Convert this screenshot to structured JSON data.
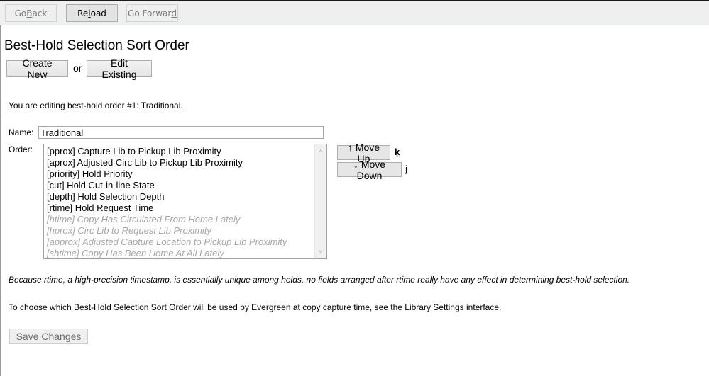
{
  "toolbar": {
    "back": {
      "pre": "Go ",
      "key": "B",
      "post": "ack"
    },
    "reload": {
      "pre": "Re",
      "key": "l",
      "post": "oad"
    },
    "forward": {
      "pre": "Go Forwar",
      "key": "d",
      "post": ""
    }
  },
  "page": {
    "title": "Best-Hold Selection Sort Order",
    "create_new": "Create New",
    "or": "or",
    "edit_existing": "Edit Existing",
    "editing_text": "You are editing best-hold order #1: Traditional.",
    "name_label": "Name:",
    "name_value": "Traditional",
    "order_label": "Order:",
    "order_items": [
      {
        "label": "[pprox] Capture Lib to Pickup Lib Proximity",
        "active": true
      },
      {
        "label": "[aprox] Adjusted Circ Lib to Pickup Lib Proximity",
        "active": true
      },
      {
        "label": "[priority] Hold Priority",
        "active": true
      },
      {
        "label": "[cut] Hold Cut-in-line State",
        "active": true
      },
      {
        "label": "[depth] Hold Selection Depth",
        "active": true
      },
      {
        "label": "[rtime] Hold Request Time",
        "active": true
      },
      {
        "label": "[htime] Copy Has Circulated From Home Lately",
        "active": false
      },
      {
        "label": "[hprox] Circ Lib to Request Lib Proximity",
        "active": false
      },
      {
        "label": "[approx] Adjusted Capture Location to Pickup Lib Proximity",
        "active": false
      },
      {
        "label": "[shtime] Copy Has Been Home At All Lately",
        "active": false
      }
    ],
    "move_up": "↑ Move Up",
    "move_up_key": "k",
    "move_down": "↓ Move Down",
    "move_down_key": "j",
    "note": "Because rtime, a high-precision timestamp, is essentially unique among holds, no fields arranged after rtime really have any effect in determining best-hold selection.",
    "hint": "To choose which Best-Hold Selection Sort Order will be used by Evergreen at copy capture time, see the Library Settings interface.",
    "save": "Save Changes"
  }
}
